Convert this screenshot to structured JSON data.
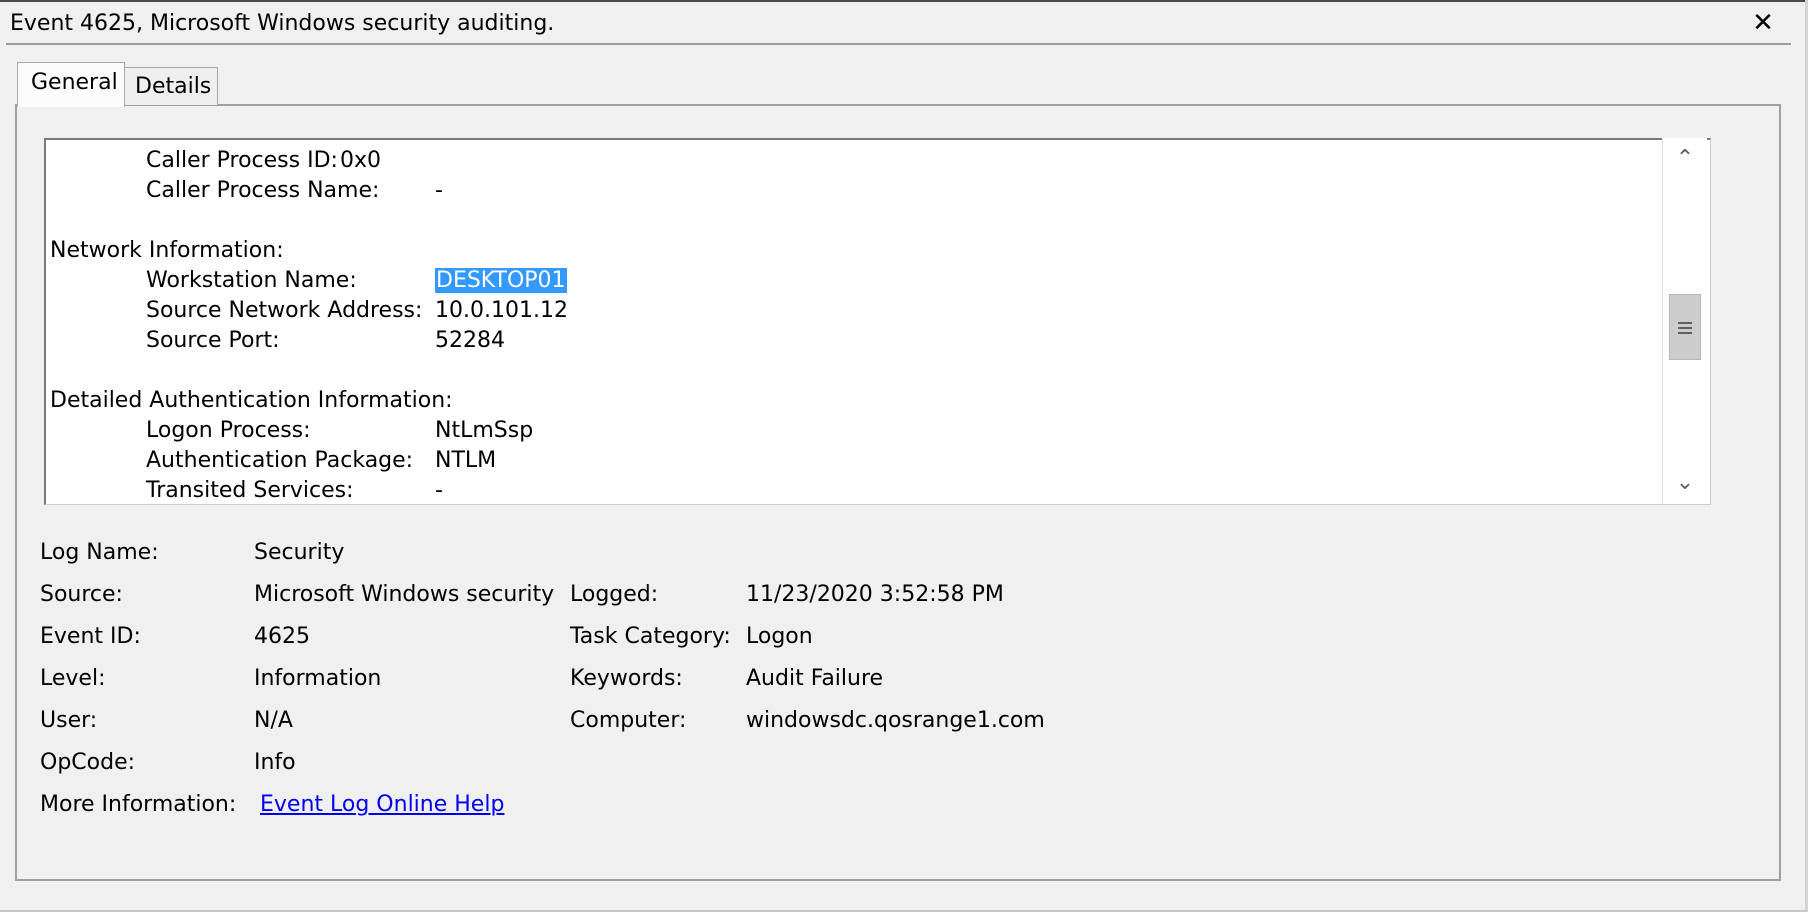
{
  "window": {
    "title": "Event 4625, Microsoft Windows security auditing.",
    "close_glyph": "✕"
  },
  "tabs": [
    {
      "label": "General",
      "active": true
    },
    {
      "label": "Details",
      "active": false
    }
  ],
  "description": {
    "caller_process_id": {
      "label": "Caller Process ID:",
      "value": "0x0"
    },
    "caller_process_name": {
      "label": "Caller Process Name:",
      "value": "-"
    },
    "network_heading": "Network Information:",
    "workstation_name": {
      "label": "Workstation Name:",
      "value": "DESKTOP01"
    },
    "source_network_address": {
      "label": "Source Network Address:",
      "value": "10.0.101.12"
    },
    "source_port": {
      "label": "Source Port:",
      "value": "52284"
    },
    "auth_heading": "Detailed Authentication Information:",
    "logon_process": {
      "label": "Logon Process:",
      "value": "NtLmSsp"
    },
    "authentication_package": {
      "label": "Authentication Package:",
      "value": "NTLM"
    },
    "transited_services": {
      "label": "Transited Services:",
      "value": "-"
    }
  },
  "scrollbar": {
    "up_glyph": "⌃",
    "down_glyph": "⌄"
  },
  "properties": {
    "log_name": {
      "label": "Log Name:",
      "value": "Security"
    },
    "source": {
      "label": "Source:",
      "value": "Microsoft Windows security"
    },
    "logged": {
      "label": "Logged:",
      "value": "11/23/2020 3:52:58 PM"
    },
    "event_id": {
      "label": "Event ID:",
      "value": "4625"
    },
    "task_category": {
      "label": "Task Category:",
      "value": "Logon"
    },
    "level": {
      "label": "Level:",
      "value": "Information"
    },
    "keywords": {
      "label": "Keywords:",
      "value": "Audit Failure"
    },
    "user": {
      "label": "User:",
      "value": "N/A"
    },
    "computer": {
      "label": "Computer:",
      "value": "windowsdc.qosrange1.com"
    },
    "opcode": {
      "label": "OpCode:",
      "value": "Info"
    },
    "more_information": {
      "label": "More Information:",
      "link_text": "Event Log Online Help"
    }
  }
}
